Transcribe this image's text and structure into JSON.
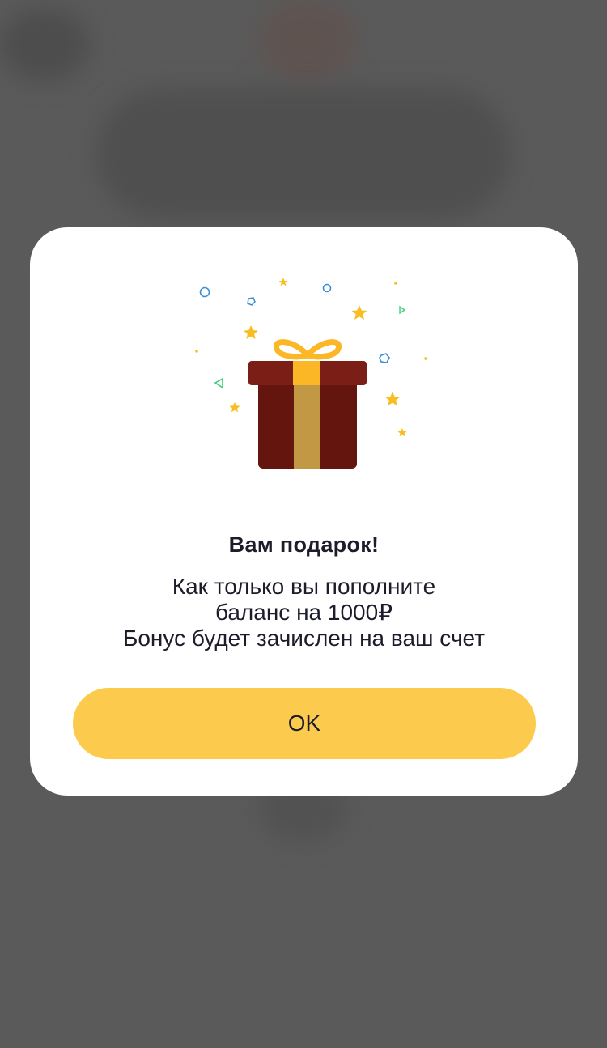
{
  "dialog": {
    "illustration_icon": "gift-icon",
    "title": "Вам подарок!",
    "message_lines": [
      "Как только вы пополните",
      "баланс на 1000₽",
      "Бонус будет зачислен на ваш счет"
    ],
    "ok_label": "OK"
  },
  "colors": {
    "overlay": "#5a5a5a",
    "dialog_background": "#ffffff",
    "button": "#fcca4d",
    "gift_box": "#64150e",
    "gift_lid": "#7a1e16",
    "ribbon": "#fbb726",
    "ribbon_band": "#c29844",
    "confetti_star": "#f8bd20",
    "confetti_blue": "#3a8fd6",
    "confetti_green": "#3fcf7a",
    "text": "#1c1c2b"
  }
}
